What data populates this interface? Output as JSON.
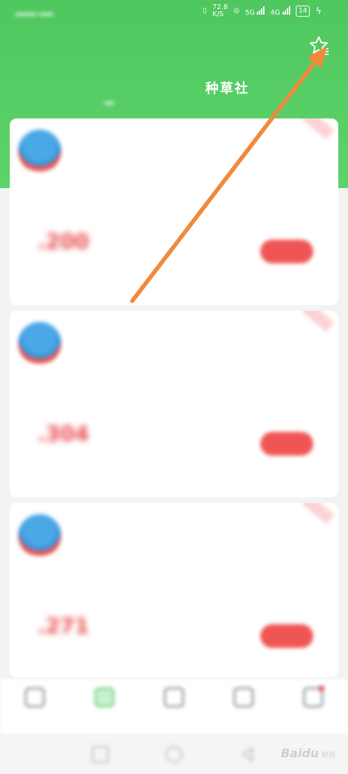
{
  "status_bar": {
    "speed_value": "72.8",
    "speed_unit": "K/S",
    "network_1": "5G",
    "network_2": "4G",
    "battery": "14"
  },
  "header": {
    "title": "",
    "tabs": [
      {
        "label": ""
      },
      {
        "label": ""
      },
      {
        "label": "种草社"
      }
    ]
  },
  "feed": {
    "cards": [
      {
        "author": "",
        "meta": "",
        "text": "",
        "price": ".200",
        "price_note": "",
        "coupon_title": "",
        "coupon_sub": "",
        "button": "",
        "tag": ""
      },
      {
        "author": "",
        "meta": "",
        "text": "",
        "price": ".304",
        "price_note": "",
        "coupon_title": "",
        "coupon_sub": "",
        "button": "",
        "tag": ""
      },
      {
        "author": "",
        "meta": "",
        "text": "",
        "price": ".271",
        "price_note": "",
        "coupon_title": "",
        "coupon_sub": "",
        "button": "",
        "tag": ""
      }
    ]
  },
  "bottom_nav": {
    "items": [
      {
        "label": "",
        "icon": "home-icon"
      },
      {
        "label": "",
        "icon": "grass-icon"
      },
      {
        "label": "",
        "icon": "bag-icon"
      },
      {
        "label": "",
        "icon": "cart-icon"
      },
      {
        "label": "",
        "icon": "user-icon"
      }
    ],
    "active_index": 1
  },
  "watermark": {
    "brand": "Baidu",
    "sub": "经验"
  },
  "colors": {
    "header_green": "#4fc75f",
    "accent_red": "#f05555",
    "annotation_arrow": "#f08a3c"
  }
}
